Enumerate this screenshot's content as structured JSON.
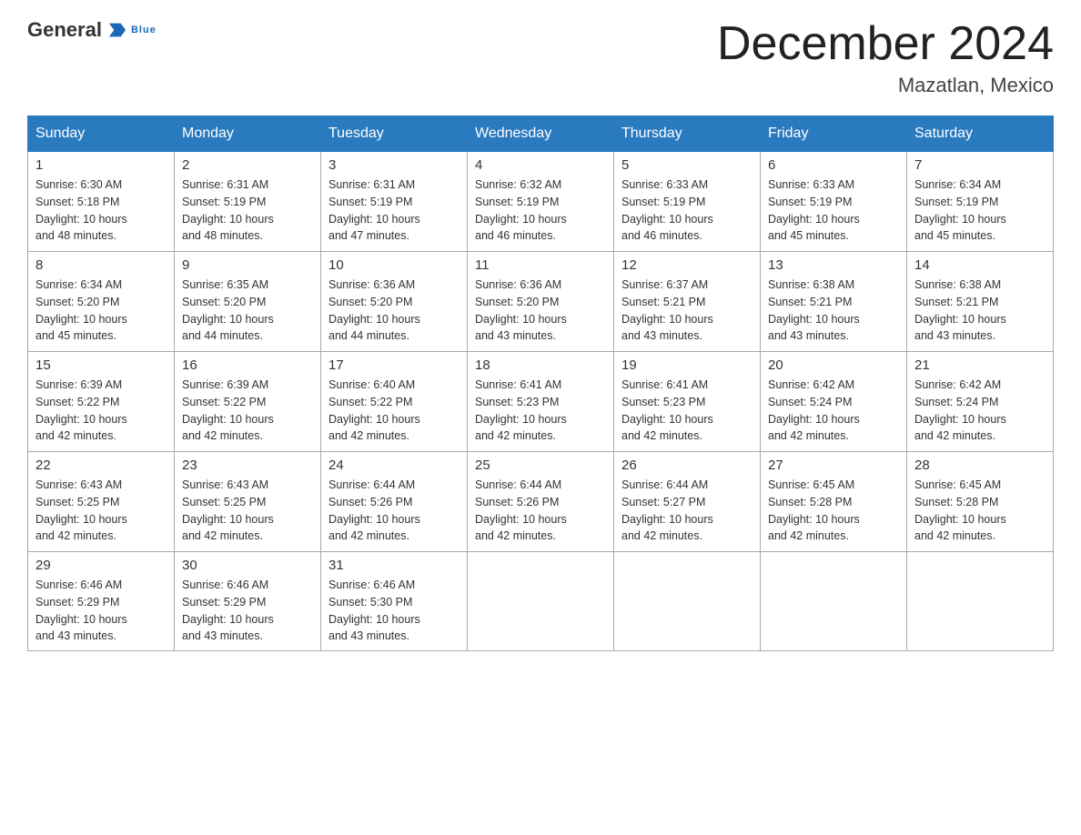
{
  "header": {
    "logo": {
      "text_general": "General",
      "text_blue": "Blue",
      "arrow_color": "#1a6ab5"
    },
    "title": "December 2024",
    "location": "Mazatlan, Mexico"
  },
  "weekdays": [
    "Sunday",
    "Monday",
    "Tuesday",
    "Wednesday",
    "Thursday",
    "Friday",
    "Saturday"
  ],
  "weeks": [
    [
      {
        "day": "1",
        "sunrise": "6:30 AM",
        "sunset": "5:18 PM",
        "daylight": "10 hours and 48 minutes."
      },
      {
        "day": "2",
        "sunrise": "6:31 AM",
        "sunset": "5:19 PM",
        "daylight": "10 hours and 48 minutes."
      },
      {
        "day": "3",
        "sunrise": "6:31 AM",
        "sunset": "5:19 PM",
        "daylight": "10 hours and 47 minutes."
      },
      {
        "day": "4",
        "sunrise": "6:32 AM",
        "sunset": "5:19 PM",
        "daylight": "10 hours and 46 minutes."
      },
      {
        "day": "5",
        "sunrise": "6:33 AM",
        "sunset": "5:19 PM",
        "daylight": "10 hours and 46 minutes."
      },
      {
        "day": "6",
        "sunrise": "6:33 AM",
        "sunset": "5:19 PM",
        "daylight": "10 hours and 45 minutes."
      },
      {
        "day": "7",
        "sunrise": "6:34 AM",
        "sunset": "5:19 PM",
        "daylight": "10 hours and 45 minutes."
      }
    ],
    [
      {
        "day": "8",
        "sunrise": "6:34 AM",
        "sunset": "5:20 PM",
        "daylight": "10 hours and 45 minutes."
      },
      {
        "day": "9",
        "sunrise": "6:35 AM",
        "sunset": "5:20 PM",
        "daylight": "10 hours and 44 minutes."
      },
      {
        "day": "10",
        "sunrise": "6:36 AM",
        "sunset": "5:20 PM",
        "daylight": "10 hours and 44 minutes."
      },
      {
        "day": "11",
        "sunrise": "6:36 AM",
        "sunset": "5:20 PM",
        "daylight": "10 hours and 43 minutes."
      },
      {
        "day": "12",
        "sunrise": "6:37 AM",
        "sunset": "5:21 PM",
        "daylight": "10 hours and 43 minutes."
      },
      {
        "day": "13",
        "sunrise": "6:38 AM",
        "sunset": "5:21 PM",
        "daylight": "10 hours and 43 minutes."
      },
      {
        "day": "14",
        "sunrise": "6:38 AM",
        "sunset": "5:21 PM",
        "daylight": "10 hours and 43 minutes."
      }
    ],
    [
      {
        "day": "15",
        "sunrise": "6:39 AM",
        "sunset": "5:22 PM",
        "daylight": "10 hours and 42 minutes."
      },
      {
        "day": "16",
        "sunrise": "6:39 AM",
        "sunset": "5:22 PM",
        "daylight": "10 hours and 42 minutes."
      },
      {
        "day": "17",
        "sunrise": "6:40 AM",
        "sunset": "5:22 PM",
        "daylight": "10 hours and 42 minutes."
      },
      {
        "day": "18",
        "sunrise": "6:41 AM",
        "sunset": "5:23 PM",
        "daylight": "10 hours and 42 minutes."
      },
      {
        "day": "19",
        "sunrise": "6:41 AM",
        "sunset": "5:23 PM",
        "daylight": "10 hours and 42 minutes."
      },
      {
        "day": "20",
        "sunrise": "6:42 AM",
        "sunset": "5:24 PM",
        "daylight": "10 hours and 42 minutes."
      },
      {
        "day": "21",
        "sunrise": "6:42 AM",
        "sunset": "5:24 PM",
        "daylight": "10 hours and 42 minutes."
      }
    ],
    [
      {
        "day": "22",
        "sunrise": "6:43 AM",
        "sunset": "5:25 PM",
        "daylight": "10 hours and 42 minutes."
      },
      {
        "day": "23",
        "sunrise": "6:43 AM",
        "sunset": "5:25 PM",
        "daylight": "10 hours and 42 minutes."
      },
      {
        "day": "24",
        "sunrise": "6:44 AM",
        "sunset": "5:26 PM",
        "daylight": "10 hours and 42 minutes."
      },
      {
        "day": "25",
        "sunrise": "6:44 AM",
        "sunset": "5:26 PM",
        "daylight": "10 hours and 42 minutes."
      },
      {
        "day": "26",
        "sunrise": "6:44 AM",
        "sunset": "5:27 PM",
        "daylight": "10 hours and 42 minutes."
      },
      {
        "day": "27",
        "sunrise": "6:45 AM",
        "sunset": "5:28 PM",
        "daylight": "10 hours and 42 minutes."
      },
      {
        "day": "28",
        "sunrise": "6:45 AM",
        "sunset": "5:28 PM",
        "daylight": "10 hours and 42 minutes."
      }
    ],
    [
      {
        "day": "29",
        "sunrise": "6:46 AM",
        "sunset": "5:29 PM",
        "daylight": "10 hours and 43 minutes."
      },
      {
        "day": "30",
        "sunrise": "6:46 AM",
        "sunset": "5:29 PM",
        "daylight": "10 hours and 43 minutes."
      },
      {
        "day": "31",
        "sunrise": "6:46 AM",
        "sunset": "5:30 PM",
        "daylight": "10 hours and 43 minutes."
      },
      null,
      null,
      null,
      null
    ]
  ],
  "labels": {
    "sunrise": "Sunrise:",
    "sunset": "Sunset:",
    "daylight": "Daylight:"
  }
}
